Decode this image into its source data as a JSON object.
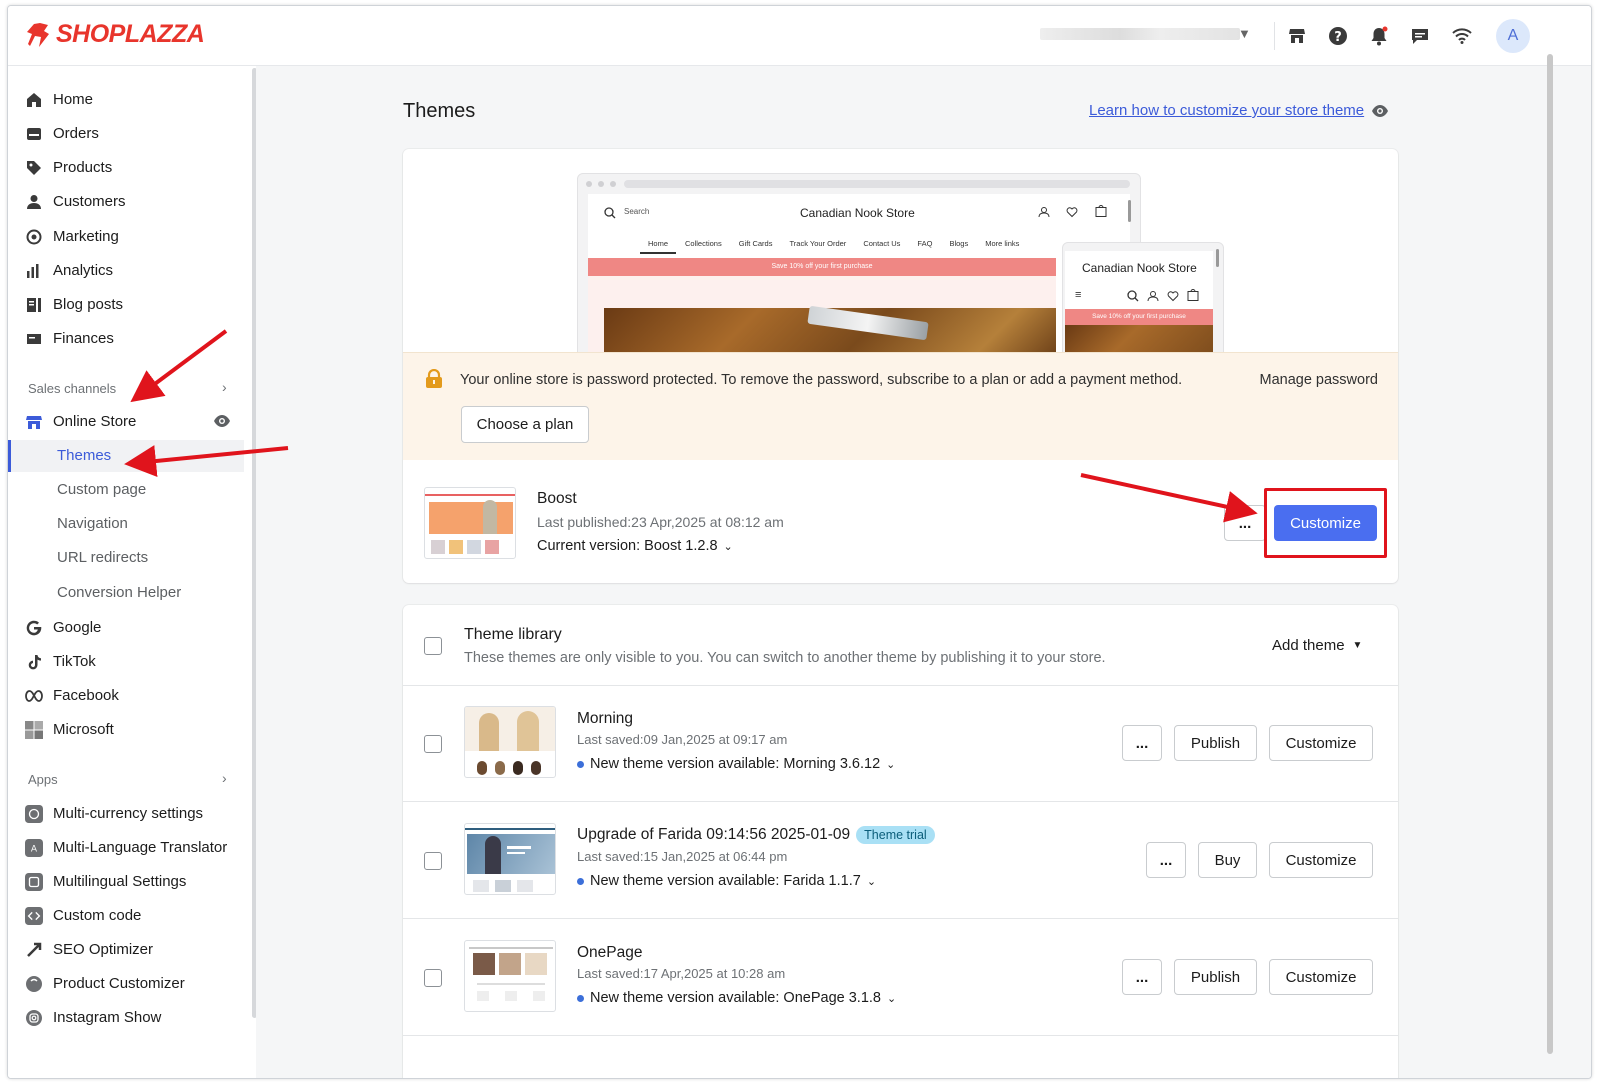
{
  "app": {
    "brand": "SHOPLAZZA",
    "avatar_letter": "A",
    "brand_color": "#e8352c",
    "accent_color": "#4a6ef0"
  },
  "topbar": {
    "icons": [
      "store-icon",
      "help-icon",
      "bell-icon",
      "chat-icon",
      "wifi-icon"
    ]
  },
  "sidebar": {
    "items": [
      {
        "label": "Home",
        "icon": "home-icon"
      },
      {
        "label": "Orders",
        "icon": "orders-icon"
      },
      {
        "label": "Products",
        "icon": "tag-icon"
      },
      {
        "label": "Customers",
        "icon": "person-icon"
      },
      {
        "label": "Marketing",
        "icon": "marketing-icon"
      },
      {
        "label": "Analytics",
        "icon": "bar-chart-icon"
      },
      {
        "label": "Blog posts",
        "icon": "blog-icon"
      },
      {
        "label": "Finances",
        "icon": "finance-icon"
      }
    ],
    "sales_channels_label": "Sales channels",
    "online_store_label": "Online Store",
    "online_store_sub": [
      "Themes",
      "Custom page",
      "Navigation",
      "URL redirects",
      "Conversion Helper"
    ],
    "channels": [
      {
        "label": "Google",
        "icon": "google-icon"
      },
      {
        "label": "TikTok",
        "icon": "tiktok-icon"
      },
      {
        "label": "Facebook",
        "icon": "meta-icon"
      },
      {
        "label": "Microsoft",
        "icon": "microsoft-icon"
      }
    ],
    "apps_label": "Apps",
    "apps": [
      {
        "label": "Multi-currency settings",
        "icon": "currency-app-icon"
      },
      {
        "label": "Multi-Language Translator",
        "icon": "translator-app-icon"
      },
      {
        "label": "Multilingual Settings",
        "icon": "multilingual-app-icon"
      },
      {
        "label": "Custom code",
        "icon": "code-app-icon"
      },
      {
        "label": "SEO Optimizer",
        "icon": "seo-app-icon"
      },
      {
        "label": "Product Customizer",
        "icon": "customizer-app-icon"
      },
      {
        "label": "Instagram Show",
        "icon": "instagram-app-icon"
      }
    ]
  },
  "main": {
    "title": "Themes",
    "learn_link": "Learn how to customize your store theme",
    "preview": {
      "store_name": "Canadian Nook Store",
      "search": "Search",
      "nav": [
        "Home",
        "Collections",
        "Gift Cards",
        "Track Your Order",
        "Contact Us",
        "FAQ",
        "Blogs",
        "More links"
      ],
      "promo": "Save 10% off your first purchase"
    },
    "password_banner": {
      "text": "Your online store is password protected. To remove the password, subscribe to a plan or add a payment method.",
      "manage": "Manage password",
      "choose_plan": "Choose a plan"
    },
    "current_theme": {
      "name": "Boost",
      "published": "Last published:23 Apr,2025 at 08:12 am",
      "version": "Current version: Boost 1.2.8",
      "more": "...",
      "customize": "Customize"
    },
    "library": {
      "title": "Theme library",
      "subtitle": "These themes are only visible to you. You can switch to another theme by publishing it to your store.",
      "add_theme": "Add theme",
      "themes": [
        {
          "name": "Morning",
          "badge": "",
          "saved": "Last saved:09 Jan,2025 at 09:17 am",
          "version": "New theme version available: Morning 3.6.12",
          "action": "Publish",
          "customize": "Customize",
          "more": "..."
        },
        {
          "name": "Upgrade of Farida 09:14:56 2025-01-09",
          "badge": "Theme trial",
          "saved": "Last saved:15 Jan,2025 at 06:44 pm",
          "version": "New theme version available: Farida 1.1.7",
          "action": "Buy",
          "customize": "Customize",
          "more": "..."
        },
        {
          "name": "OnePage",
          "badge": "",
          "saved": "Last saved:17 Apr,2025 at 10:28 am",
          "version": "New theme version available: OnePage 3.1.8",
          "action": "Publish",
          "customize": "Customize",
          "more": "..."
        }
      ]
    }
  }
}
